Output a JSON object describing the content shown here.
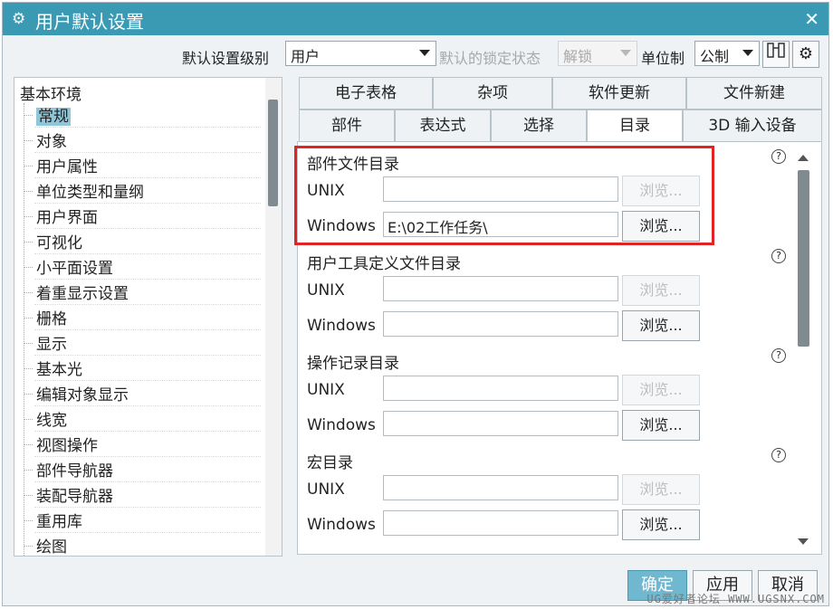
{
  "window": {
    "title": "用户默认设置",
    "close_icon": "close-icon"
  },
  "topbar": {
    "level_label": "默认设置级别",
    "level_value": "用户",
    "lock_label": "默认的锁定状态",
    "lock_value": "解锁",
    "unit_label": "单位制",
    "unit_value": "公制"
  },
  "tree": {
    "root": "基本环境",
    "items": [
      "常规",
      "对象",
      "用户属性",
      "单位类型和量纲",
      "用户界面",
      "可视化",
      "小平面设置",
      "着重显示设置",
      "栅格",
      "显示",
      "基本光",
      "编辑对象显示",
      "线宽",
      "视图操作",
      "部件导航器",
      "装配导航器",
      "重用库",
      "绘图"
    ],
    "selected": "常规"
  },
  "tabs": {
    "row1": [
      "电子表格",
      "杂项",
      "软件更新",
      "文件新建"
    ],
    "row2": [
      "部件",
      "表达式",
      "选择",
      "目录",
      "3D 输入设备"
    ],
    "active": "目录"
  },
  "sections": [
    {
      "title": "部件文件目录",
      "unix_label": "UNIX",
      "unix_value": "",
      "windows_label": "Windows",
      "windows_value": "E:\\02工作任务\\",
      "browse": "浏览..."
    },
    {
      "title": "用户工具定义文件目录",
      "unix_label": "UNIX",
      "unix_value": "",
      "windows_label": "Windows",
      "windows_value": "",
      "browse": "浏览..."
    },
    {
      "title": "操作记录目录",
      "unix_label": "UNIX",
      "unix_value": "",
      "windows_label": "Windows",
      "windows_value": "",
      "browse": "浏览..."
    },
    {
      "title": "宏目录",
      "unix_label": "UNIX",
      "unix_value": "",
      "windows_label": "Windows",
      "windows_value": "",
      "browse": "浏览..."
    }
  ],
  "footer": {
    "ok": "确定",
    "apply": "应用",
    "cancel": "取消",
    "watermark": "UG爱好者论坛 WWW.UGSNX.COM"
  },
  "colors": {
    "titlebar": "#3a9ab4",
    "highlight": "#e02424",
    "selected": "#8fc6d9"
  }
}
